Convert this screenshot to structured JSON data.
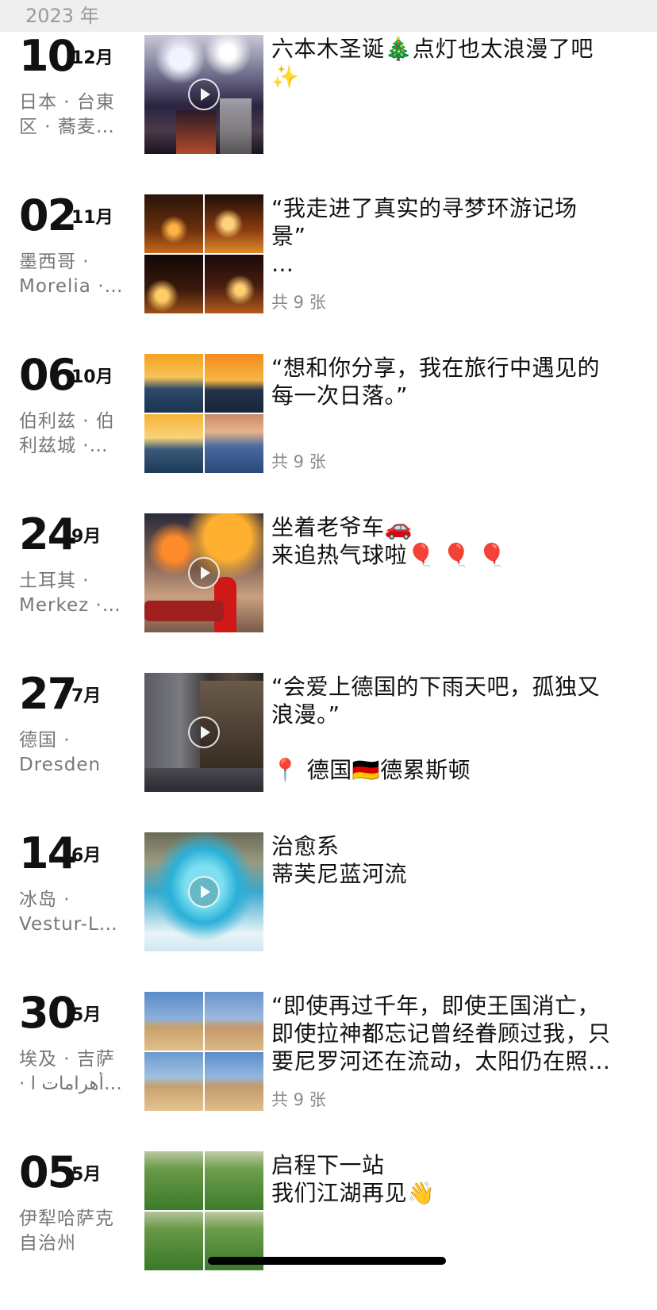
{
  "year_header": "2023 年",
  "entries": [
    {
      "day": "10",
      "month": "12月",
      "location": [
        "日本 · 台東",
        "区 · 蕎麦…"
      ],
      "caption": [
        "六本木圣诞🎄点灯也太浪漫了吧",
        "✨"
      ],
      "photo_count": "",
      "media": "video"
    },
    {
      "day": "02",
      "month": "11月",
      "location": [
        "墨西哥 ·",
        "Morelia ·…"
      ],
      "caption": [
        "“我走进了真实的寻梦环游记场",
        "景”",
        "…"
      ],
      "photo_count": "共 9 张",
      "media": "grid"
    },
    {
      "day": "06",
      "month": "10月",
      "location": [
        "伯利兹 · 伯",
        "利兹城 ·…"
      ],
      "caption": [
        "“想和你分享，我在旅行中遇见的",
        "每一次日落。”"
      ],
      "photo_count": "共 9 张",
      "media": "grid"
    },
    {
      "day": "24",
      "month": "9月",
      "location": [
        "土耳其 ·",
        "Merkez ·…"
      ],
      "caption": [
        "坐着老爷车🚗",
        "来追热气球啦🎈 🎈 🎈"
      ],
      "photo_count": "",
      "media": "video"
    },
    {
      "day": "27",
      "month": "7月",
      "location": [
        "德国 ·",
        "Dresden"
      ],
      "caption": [
        "“会爱上德国的下雨天吧，孤独又",
        "浪漫。”",
        "",
        "📍 德国🇩🇪德累斯顿"
      ],
      "photo_count": "",
      "media": "video"
    },
    {
      "day": "14",
      "month": "6月",
      "location": [
        "冰岛 ·",
        "Vestur-L…"
      ],
      "caption": [
        "治愈系",
        "蒂芙尼蓝河流"
      ],
      "photo_count": "",
      "media": "video"
    },
    {
      "day": "30",
      "month": "5月",
      "location": [
        "埃及 · 吉萨",
        "· أهرامات ا…"
      ],
      "caption": [
        "“即使再过千年，即使王国消亡，",
        "即使拉神都忘记曾经眷顾过我，只",
        "要尼罗河还在流动，太阳仍在照…"
      ],
      "photo_count": "共 9 张",
      "media": "grid"
    },
    {
      "day": "05",
      "month": "5月",
      "location": [
        "伊犁哈萨克",
        "自治州"
      ],
      "caption": [
        "启程下一站",
        "我们江湖再见👋"
      ],
      "photo_count": "",
      "media": "grid"
    }
  ]
}
